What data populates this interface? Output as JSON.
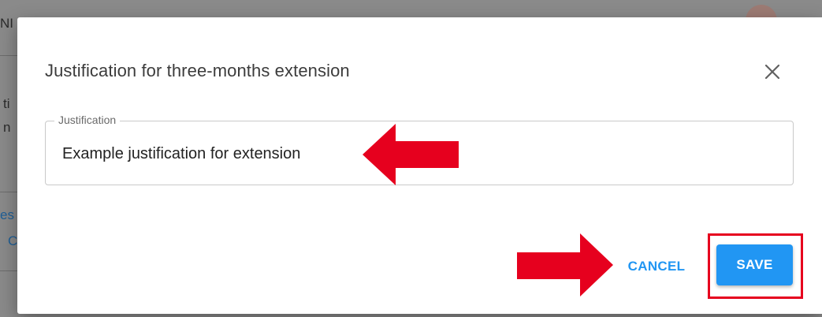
{
  "background": {
    "fragments": [
      {
        "text": "NI",
        "role": "header"
      },
      {
        "text": "ti",
        "role": "text"
      },
      {
        "text": "n",
        "role": "text"
      },
      {
        "text": "es",
        "role": "link"
      },
      {
        "text": "C",
        "role": "link"
      }
    ]
  },
  "dialog": {
    "title": "Justification for three-months extension",
    "close_icon": "close-icon",
    "field": {
      "label": "Justification",
      "value": "Example justification for extension",
      "placeholder": ""
    },
    "actions": {
      "cancel_label": "CANCEL",
      "save_label": "SAVE"
    }
  },
  "annotations": {
    "arrows": [
      "left-pointing-arrow",
      "right-pointing-arrow"
    ],
    "highlight": "save-highlight-box"
  },
  "colors": {
    "accent": "#2196f3",
    "annotation_red": "#e6001e",
    "overlay": "#7b7b7b"
  }
}
